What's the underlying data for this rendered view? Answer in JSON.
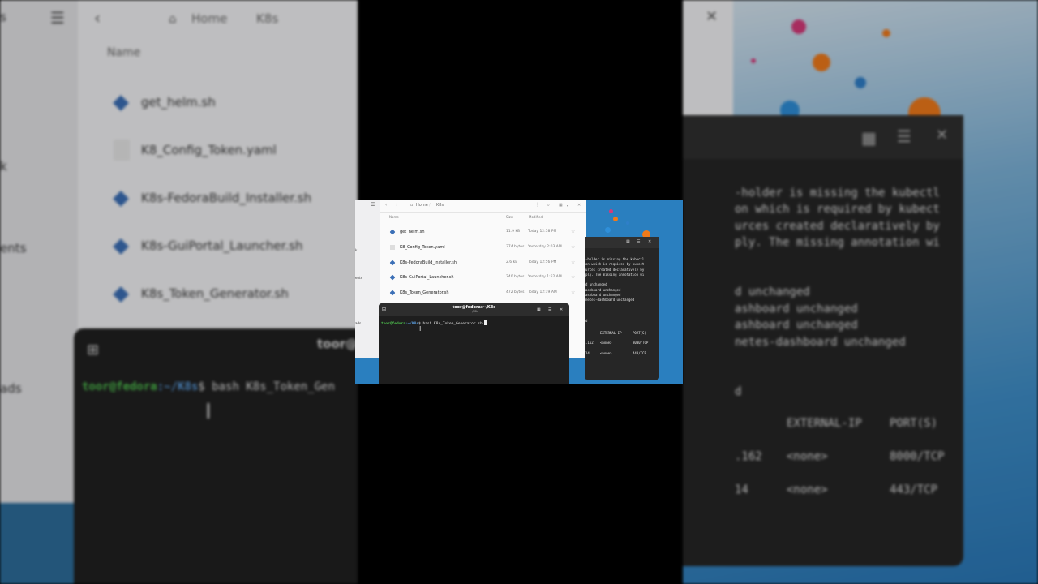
{
  "bg_files": {
    "breadcrumb": [
      "Home",
      "K8s"
    ],
    "column_name": "Name",
    "files": [
      "get_helm.sh",
      "K8_Config_Token.yaml",
      "K8s-FedoraBuild_Installer.sh",
      "K8s-GuiPortal_Launcher.sh",
      "K8s_Token_Generator.sh"
    ],
    "sidebar_fragments": [
      "s",
      "k",
      "ents",
      "ads"
    ],
    "term_title": "toor@",
    "prompt_user": "toor@fedora",
    "prompt_path": ":~/K8s",
    "prompt_symbol": "$",
    "command": " bash K8s_Token_Gen"
  },
  "bg_right_term": {
    "lines": [
      "-holder is missing the kubectl",
      "on which is required by kubect",
      "urces created declaratively by",
      "ply. The missing annotation wi",
      "",
      "",
      "d unchanged",
      "ashboard unchanged",
      "ashboard unchanged",
      "netes-dashboard unchanged",
      "",
      "",
      "d",
      "",
      "",
      "",
      "",
      ""
    ],
    "table_header": [
      "EXTERNAL-IP",
      "PORT(S)"
    ],
    "table_rows": [
      [
        ".162",
        "<none>",
        "8000/TCP"
      ],
      [
        "14",
        "<none>",
        "443/TCP"
      ]
    ]
  },
  "center": {
    "files_window": {
      "breadcrumb": [
        "Home",
        "K8s"
      ],
      "columns": {
        "name": "Name",
        "size": "Size",
        "modified": "Modified"
      },
      "rows": [
        {
          "name": "get_helm.sh",
          "size": "11.9 kB",
          "modified": "Today 12:58 PM"
        },
        {
          "name": "K8_Config_Token.yaml",
          "size": "374 bytes",
          "modified": "Yesterday 2:03 AM"
        },
        {
          "name": "K8s-FedoraBuild_Installer.sh",
          "size": "2.6 kB",
          "modified": "Today 12:56 PM"
        },
        {
          "name": "K8s-GuiPortal_Launcher.sh",
          "size": "240 bytes",
          "modified": "Yesterday 1:52 AM"
        },
        {
          "name": "K8s_Token_Generator.sh",
          "size": "472 bytes",
          "modified": "Today 12:19 AM"
        }
      ],
      "sidebar_fragments": [
        "k",
        "ents",
        "ads"
      ]
    },
    "terminal": {
      "title": "toor@fedora:~/K8s",
      "subtitle": "~/K8s",
      "prompt_user": "toor@fedora",
      "prompt_path": ":~/K8s",
      "prompt_symbol": "$",
      "command": " bash K8s_Token_Generator.sh "
    },
    "terminal2": {
      "lines": [
        "-holder is missing the kubectl",
        "on which is required by kubect",
        "urces created declaratively by",
        "ply. The missing annotation wi",
        "",
        "d unchanged",
        "ashboard unchanged",
        "ashboard unchanged",
        "netes-dashboard unchanged",
        "",
        "d"
      ],
      "table_header": [
        "EXTERNAL-IP",
        "PORT(S)"
      ],
      "table_rows": [
        [
          ".162",
          "<none>",
          "8000/TCP"
        ],
        [
          "14",
          "<none>",
          "443/TCP"
        ]
      ]
    }
  }
}
